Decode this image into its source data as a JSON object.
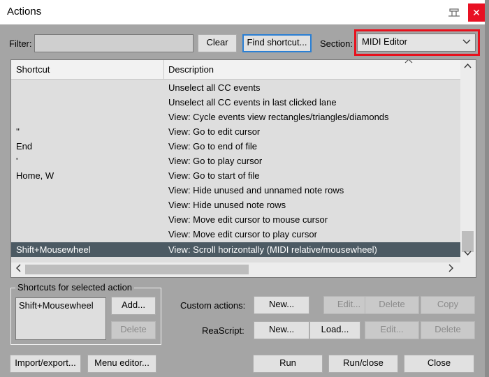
{
  "window": {
    "title": "Actions",
    "close_label": "✕"
  },
  "filter": {
    "label": "Filter:",
    "value": "",
    "clear_label": "Clear",
    "find_shortcut_label": "Find shortcut...",
    "section_label": "Section:",
    "section_value": "MIDI Editor"
  },
  "table": {
    "columns": [
      "Shortcut",
      "Description"
    ],
    "rows": [
      {
        "shortcut": "",
        "description": "Unselect all CC events"
      },
      {
        "shortcut": "",
        "description": "Unselect all CC events in last clicked lane"
      },
      {
        "shortcut": "",
        "description": "View: Cycle events view rectangles/triangles/diamonds"
      },
      {
        "shortcut": "''",
        "description": "View: Go to edit cursor"
      },
      {
        "shortcut": "End",
        "description": "View: Go to end of file"
      },
      {
        "shortcut": "'",
        "description": "View: Go to play cursor"
      },
      {
        "shortcut": "Home, W",
        "description": "View: Go to start of file"
      },
      {
        "shortcut": "",
        "description": "View: Hide unused and unnamed note rows"
      },
      {
        "shortcut": "",
        "description": "View: Hide unused note rows"
      },
      {
        "shortcut": "",
        "description": "View: Move edit cursor to mouse cursor"
      },
      {
        "shortcut": "",
        "description": "View: Move edit cursor to play cursor"
      },
      {
        "shortcut": "Shift+Mousewheel",
        "description": "View: Scroll horizontally (MIDI relative/mousewheel)",
        "selected": true
      }
    ]
  },
  "shortcuts_group": {
    "title": "Shortcuts for selected action",
    "items": [
      "Shift+Mousewheel"
    ],
    "add_label": "Add...",
    "delete_label": "Delete"
  },
  "custom_actions": {
    "label": "Custom actions:",
    "new_label": "New...",
    "edit_label": "Edit...",
    "delete_label": "Delete",
    "copy_label": "Copy"
  },
  "reascript": {
    "label": "ReaScript:",
    "new_label": "New...",
    "load_label": "Load...",
    "edit_label": "Edit...",
    "delete_label": "Delete"
  },
  "bottom": {
    "import_export_label": "Import/export...",
    "menu_editor_label": "Menu editor...",
    "run_label": "Run",
    "run_close_label": "Run/close",
    "close_label": "Close"
  },
  "colors": {
    "accent_highlight": "#e8101c",
    "selected_row": "#4c5a63",
    "close_button": "#e81123"
  }
}
